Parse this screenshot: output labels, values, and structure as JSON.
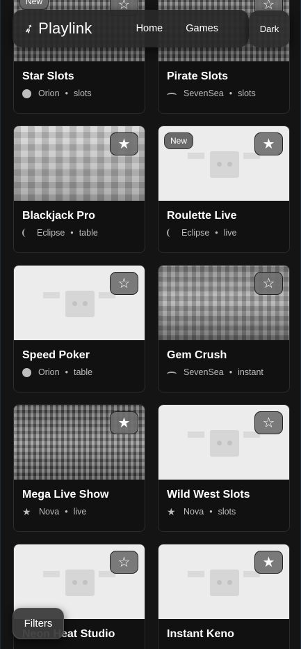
{
  "brand": {
    "name": "Playlink"
  },
  "nav": {
    "home": "Home",
    "games": "Games"
  },
  "theme_toggle": "Dark",
  "filters_label": "Filters",
  "games": [
    {
      "title": "Star Slots",
      "provider": "Orion",
      "category": "slots",
      "favorite": false,
      "is_new": true,
      "new_label": "New",
      "provider_icon": "circle",
      "thumb": "pixel-dark"
    },
    {
      "title": "Pirate Slots",
      "provider": "SevenSea",
      "category": "slots",
      "favorite": false,
      "is_new": false,
      "provider_icon": "wave",
      "thumb": "pixel-dark"
    },
    {
      "title": "Blackjack Pro",
      "provider": "Eclipse",
      "category": "table",
      "favorite": true,
      "is_new": false,
      "provider_icon": "crescent",
      "thumb": "pixel-light"
    },
    {
      "title": "Roulette Live",
      "provider": "Eclipse",
      "category": "live",
      "favorite": true,
      "is_new": true,
      "new_label": "New",
      "provider_icon": "crescent",
      "thumb": "placeholder"
    },
    {
      "title": "Speed Poker",
      "provider": "Orion",
      "category": "table",
      "favorite": false,
      "is_new": false,
      "provider_icon": "circle",
      "thumb": "placeholder"
    },
    {
      "title": "Gem Crush",
      "provider": "SevenSea",
      "category": "instant",
      "favorite": false,
      "is_new": false,
      "provider_icon": "wave",
      "thumb": "pixel"
    },
    {
      "title": "Mega Live Show",
      "provider": "Nova",
      "category": "live",
      "favorite": true,
      "is_new": false,
      "provider_icon": "star",
      "thumb": "pixel-dark"
    },
    {
      "title": "Wild West Slots",
      "provider": "Nova",
      "category": "slots",
      "favorite": false,
      "is_new": false,
      "provider_icon": "star",
      "thumb": "placeholder"
    },
    {
      "title": "Neon Heat Studio",
      "provider": "",
      "category": "",
      "favorite": false,
      "is_new": false,
      "provider_icon": "circle",
      "thumb": "placeholder"
    },
    {
      "title": "Instant Keno",
      "provider": "",
      "category": "",
      "favorite": true,
      "is_new": false,
      "provider_icon": "circle",
      "thumb": "placeholder"
    }
  ],
  "icons": {
    "favorite_on": "★",
    "favorite_off": "☆",
    "logo": "rocket-icon",
    "separator": "•"
  }
}
